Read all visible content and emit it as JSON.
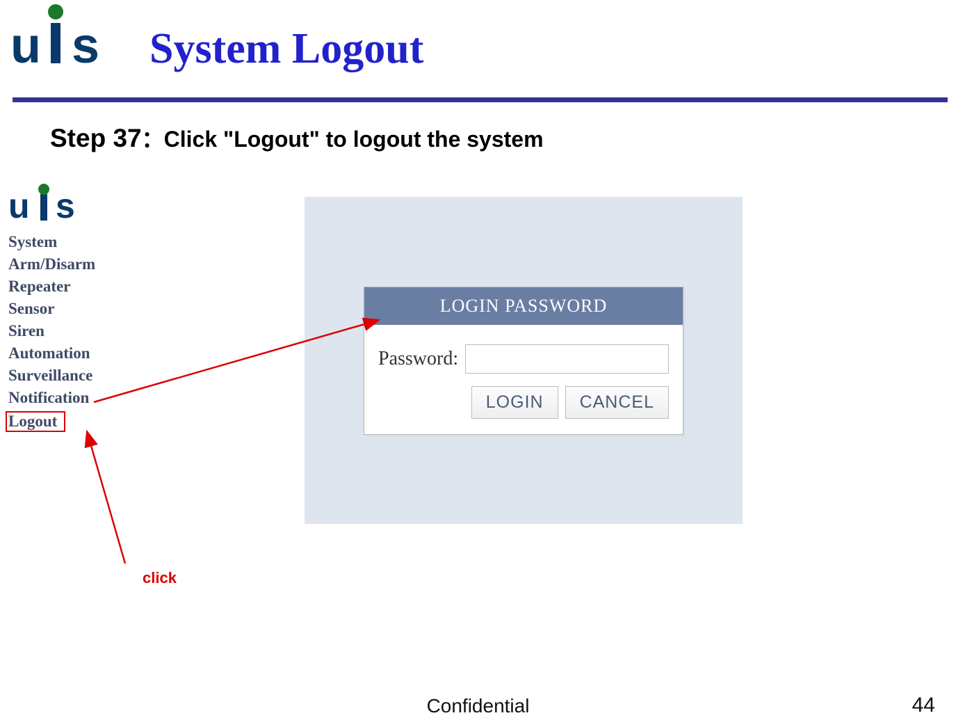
{
  "header": {
    "title": "System Logout",
    "logo_text": "uis"
  },
  "step": {
    "label": "Step 37",
    "sep": "：",
    "desc": "Click \"Logout\" to logout the system"
  },
  "sidebar": {
    "items": [
      {
        "label": "System"
      },
      {
        "label": "Arm/Disarm"
      },
      {
        "label": "Repeater"
      },
      {
        "label": "Sensor"
      },
      {
        "label": "Siren"
      },
      {
        "label": "Automation"
      },
      {
        "label": "Surveillance"
      },
      {
        "label": "Notification"
      },
      {
        "label": "Logout"
      }
    ]
  },
  "login_box": {
    "header": "LOGIN PASSWORD",
    "label": "Password:",
    "login_btn": "LOGIN",
    "cancel_btn": "CANCEL"
  },
  "annotation": {
    "click": "click"
  },
  "footer": {
    "confidential": "Confidential",
    "page": "44"
  }
}
